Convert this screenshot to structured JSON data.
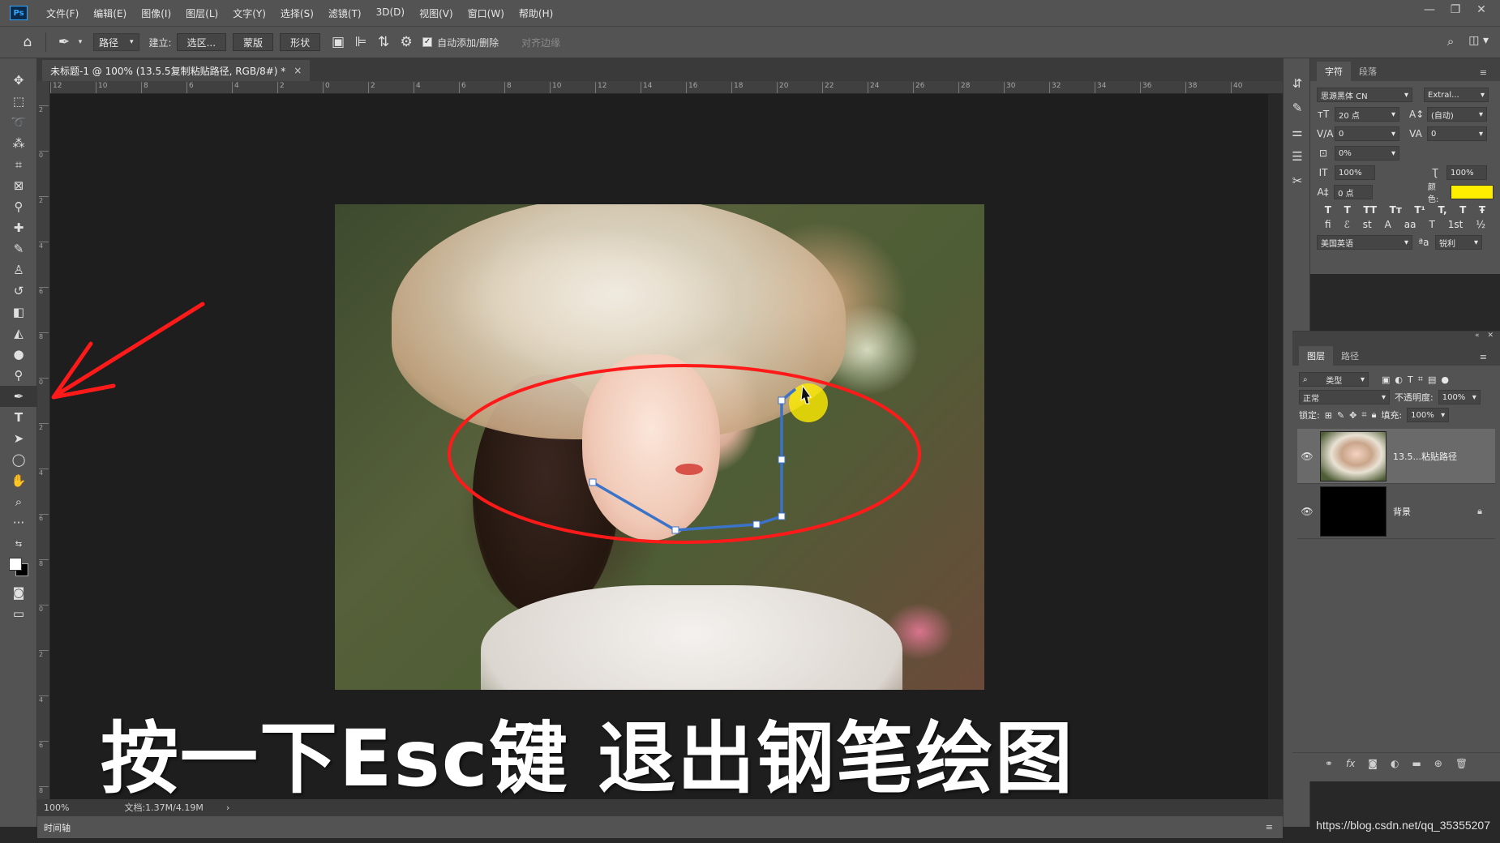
{
  "app": {
    "logo_text": "Ps"
  },
  "menu": [
    "文件(F)",
    "编辑(E)",
    "图像(I)",
    "图层(L)",
    "文字(Y)",
    "选择(S)",
    "滤镜(T)",
    "3D(D)",
    "视图(V)",
    "窗口(W)",
    "帮助(H)"
  ],
  "window_controls": {
    "minimize": "—",
    "restore": "❐",
    "close": "✕"
  },
  "options": {
    "mode_select": "路径",
    "make_label": "建立:",
    "selection_btn": "选区...",
    "mask_btn": "蒙版",
    "shape_btn": "形状",
    "auto_add_delete_label": "自动添加/删除",
    "auto_add_delete_checked": true,
    "align_edges_label": "对齐边缘"
  },
  "document": {
    "tab_title": "未标题-1 @ 100% (13.5.5复制粘贴路径, RGB/8#) *",
    "close": "×"
  },
  "ruler_h": [
    "12",
    "10",
    "8",
    "6",
    "4",
    "2",
    "0",
    "2",
    "4",
    "6",
    "8",
    "10",
    "12",
    "14",
    "16",
    "18",
    "20",
    "22",
    "24",
    "26",
    "28",
    "30",
    "32",
    "34",
    "36",
    "38",
    "40"
  ],
  "ruler_v": [
    "2",
    "0",
    "2",
    "4",
    "6",
    "8",
    "0",
    "2",
    "4",
    "6",
    "8",
    "0",
    "2",
    "4",
    "6",
    "8"
  ],
  "status": {
    "zoom": "100%",
    "doc_size": "文档:1.37M/4.19M",
    "arrow": "›"
  },
  "timeline": {
    "label": "时间轴"
  },
  "character_panel": {
    "tab_character": "字符",
    "tab_paragraph": "段落",
    "font_family": "思源黑体 CN",
    "font_style": "Extral...",
    "font_size": "20 点",
    "leading": "(自动)",
    "kerning": "0",
    "tracking": "0",
    "scale_pct": "0%",
    "vertical_scale": "100%",
    "horizontal_scale": "100%",
    "baseline_shift": "0 点",
    "color_label": "颜色:",
    "color_value": "#ffee00",
    "language": "美国英语",
    "aa_icon": "ªa",
    "anti_alias": "锐利",
    "format_buttons": [
      "T",
      "T",
      "TT",
      "Tт",
      "T¹",
      "T,",
      "T",
      "Ŧ"
    ],
    "opentype_buttons": [
      "fi",
      "ℰ",
      "st",
      "A",
      "aa",
      "T",
      "1st",
      "½"
    ]
  },
  "layers_panel": {
    "tab_layers": "图层",
    "tab_paths": "路径",
    "filter_kind": "类型",
    "blend_mode": "正常",
    "opacity_label": "不透明度:",
    "opacity_value": "100%",
    "lock_label": "锁定:",
    "fill_label": "填充:",
    "fill_value": "100%",
    "layers": [
      {
        "name": "13.5...粘贴路径",
        "selected": true
      },
      {
        "name": "背景",
        "locked": true
      }
    ]
  },
  "caption": "按一下Esc键 退出钢笔绘图",
  "watermark": "https://blog.csdn.net/qq_35355207",
  "colors": {
    "annotation_red": "#ff1a1a",
    "path_blue": "#3b73c8",
    "cursor_highlight": "#ffee00"
  }
}
